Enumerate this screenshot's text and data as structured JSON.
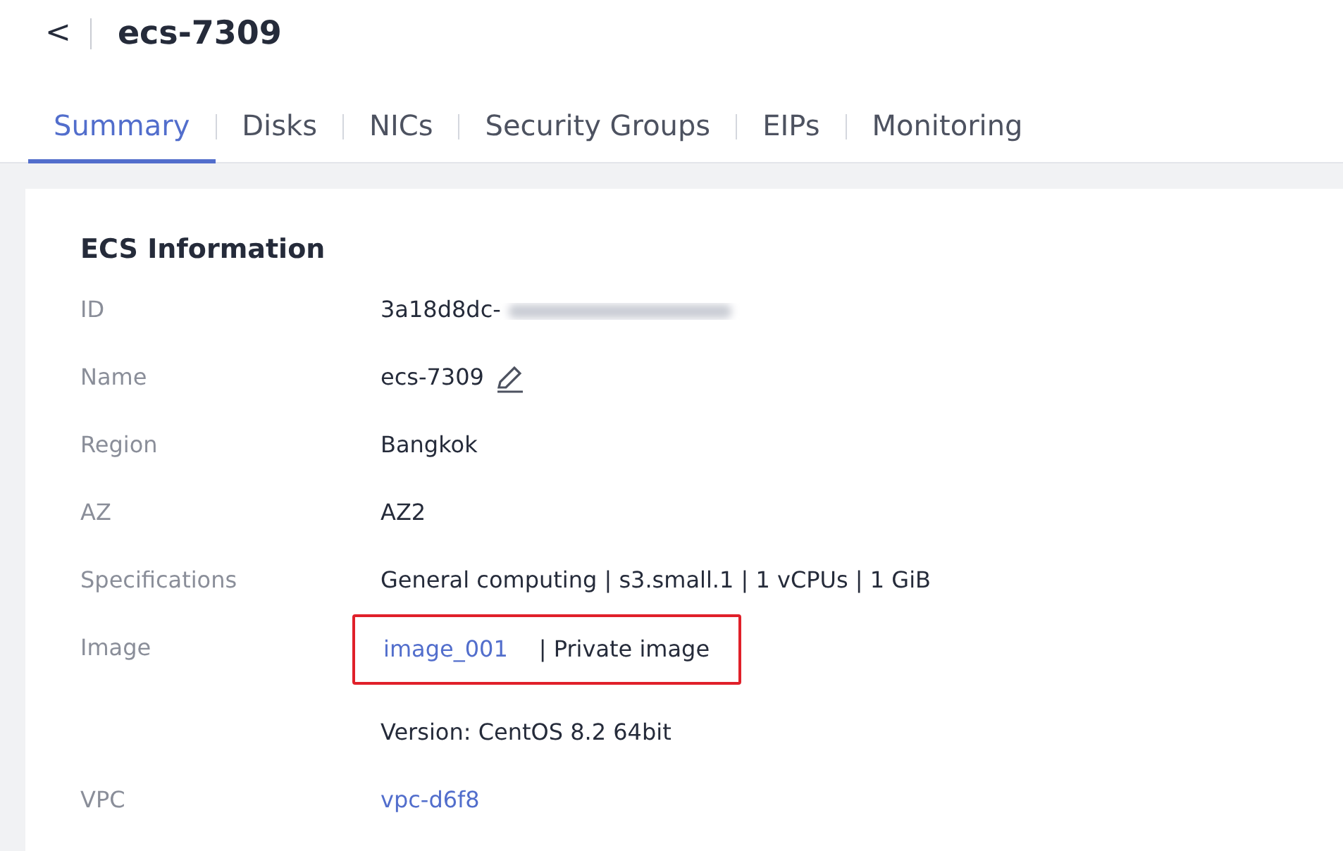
{
  "header": {
    "back": "<",
    "title": "ecs-7309"
  },
  "tabs": [
    {
      "label": "Summary",
      "selected": true
    },
    {
      "label": "Disks",
      "selected": false
    },
    {
      "label": "NICs",
      "selected": false
    },
    {
      "label": "Security Groups",
      "selected": false
    },
    {
      "label": "EIPs",
      "selected": false
    },
    {
      "label": "Monitoring",
      "selected": false
    }
  ],
  "section": {
    "title": "ECS Information",
    "rows": [
      {
        "label": "ID",
        "kind": "redacted",
        "value": "3a18d8dc-"
      },
      {
        "label": "Name",
        "kind": "editable",
        "value": "ecs-7309"
      },
      {
        "label": "Region",
        "kind": "text",
        "value": "Bangkok"
      },
      {
        "label": "AZ",
        "kind": "text",
        "value": "AZ2"
      },
      {
        "label": "Specifications",
        "kind": "text",
        "value": "General computing | s3.small.1 | 1 vCPUs | 1 GiB"
      },
      {
        "label": "Image",
        "kind": "image",
        "link": "image_001",
        "value": "| Private image",
        "highlighted": true,
        "note": "Version: CentOS 8.2 64bit"
      },
      {
        "label": "VPC",
        "kind": "link",
        "value": "vpc-d6f8"
      }
    ]
  }
}
